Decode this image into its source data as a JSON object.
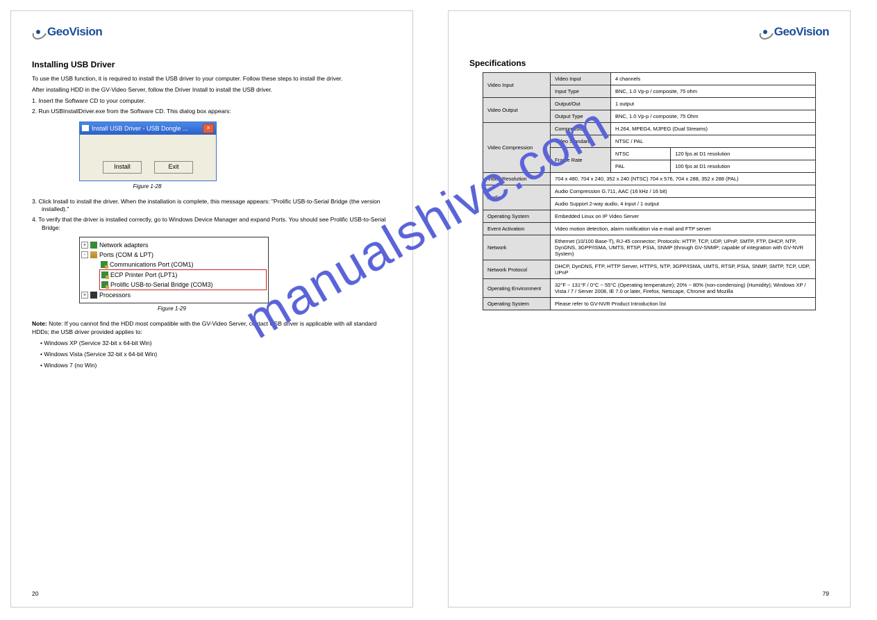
{
  "brand": "GeoVision",
  "watermark": "manualshive.com",
  "left": {
    "title": "Installing USB Driver",
    "intro1": "To use the USB function, it is required to install the USB driver to your computer. Follow these steps to install the driver.",
    "intro2": "After installing HDD in the GV-Video Server, follow the Driver Install to install the USB driver.",
    "step1": "1. Insert the Software CD to your computer.",
    "step2": "2. Run USBInstallDriver.exe from the Software CD. This dialog box appears:",
    "dialog": {
      "title": "Install USB Driver - USB Dongle ...",
      "install": "Install",
      "exit": "Exit",
      "close": "×"
    },
    "fig1": "Figure 1-28",
    "step3": "3. Click Install to install the driver. When the installation is complete, this message appears: \"Prolific USB-to-Serial Bridge (the version installed).\"",
    "step4": "4. To verify that the driver is installed correctly, go to Windows Device Manager and expand Ports. You should see Prolific USB-to-Serial Bridge:",
    "tree": {
      "net": "Network adapters",
      "ports": "Ports (COM & LPT)",
      "com1": "Communications Port (COM1)",
      "lpt1": "ECP Printer Port (LPT1)",
      "bridge": "Prolific USB-to-Serial Bridge (COM3)",
      "proc": "Processors"
    },
    "fig2": "Figure 1-29",
    "note": "Note: If you cannot find the HDD most compatible with the GV-Video Server, contact USB driver is applicable with all standard HDDs; the USB driver provided applies to:",
    "noteA": "• Windows XP (Service 32-bit x 64-bit Win)",
    "noteB": "• Windows Vista (Service 32-bit x 64-bit Win)",
    "noteC": "• Windows 7 (no Win)",
    "page_num": "20"
  },
  "right": {
    "title": "Specifications",
    "table": {
      "r1a": "Video Input",
      "r1b": "Video Input",
      "r1c": "4 channels",
      "r2b": "Input Type",
      "r2c": "BNC, 1.0 Vp-p / composite, 75 ohm",
      "r3a": "Video Output",
      "r3b": "Output/Out",
      "r3c": "1 output",
      "r4b": "Output Type",
      "r4c": "BNC, 1.0 Vp-p / composite, 75 Ohm",
      "r5a": "Video Compression",
      "r5b": "Compression",
      "r5c": "H.264, MPEG4, MJPEG (Dual Streams)",
      "r6b": "Video Standard",
      "r6c": "NTSC / PAL",
      "r7b": "Frame Rate",
      "r7c1": "NTSC",
      "r7c2": "120 fps at D1 resolution",
      "r8c1": "PAL",
      "r8c2": "100 fps at D1 resolution",
      "r9a": "Video Resolution",
      "r9c": "704 x 480, 704 x 240, 352 x 240 (NTSC)\n704 x 576, 704 x 288, 352 x 288 (PAL)",
      "r10a": "Audio",
      "r10c": "Audio Compression G.711, AAC (16 kHz / 16 bit)",
      "r11c": "Audio Support   2-way audio, 4 input / 1 output",
      "r12a": "Operating System",
      "r12c": "Embedded Linux on IP Video Server",
      "r13a": "Event Activation",
      "r13c": "Video motion detection, alarm notification via e-mail and FTP server",
      "r14a": "Network",
      "r14c": "Ethernet (10/100 Base-T), RJ-45 connector; Protocols: HTTP, TCP, UDP, UPnP, SMTP, FTP, DHCP, NTP, DynDNS, 3GPP/ISMA, UMTS, RTSP, PSIA, SNMP (through GV-SNMP; capable of integration with GV-NVR System)",
      "r15a": "Network Protocol",
      "r15c": "DHCP, DynDNS, FTP, HTTP Server, HTTPS, NTP, 3GPP/ISMA, UMTS, RTSP, PSIA, SNMP, SMTP, TCP, UDP, UPnP",
      "r16a": "Operating Environment",
      "r16c": "32°F ~ 131°F / 0°C ~ 55°C (Operating temperature); 20% ~ 80% (non-condensing) (Humidity); Windows XP / Vista / 7 / Server 2008, IE 7.0 or later, Firefox, Netscape, Chrome and Mozilla",
      "r17a": "Operating System",
      "r17c": "Please refer to GV-NVR Product Introduction list"
    },
    "page_num": "79"
  }
}
